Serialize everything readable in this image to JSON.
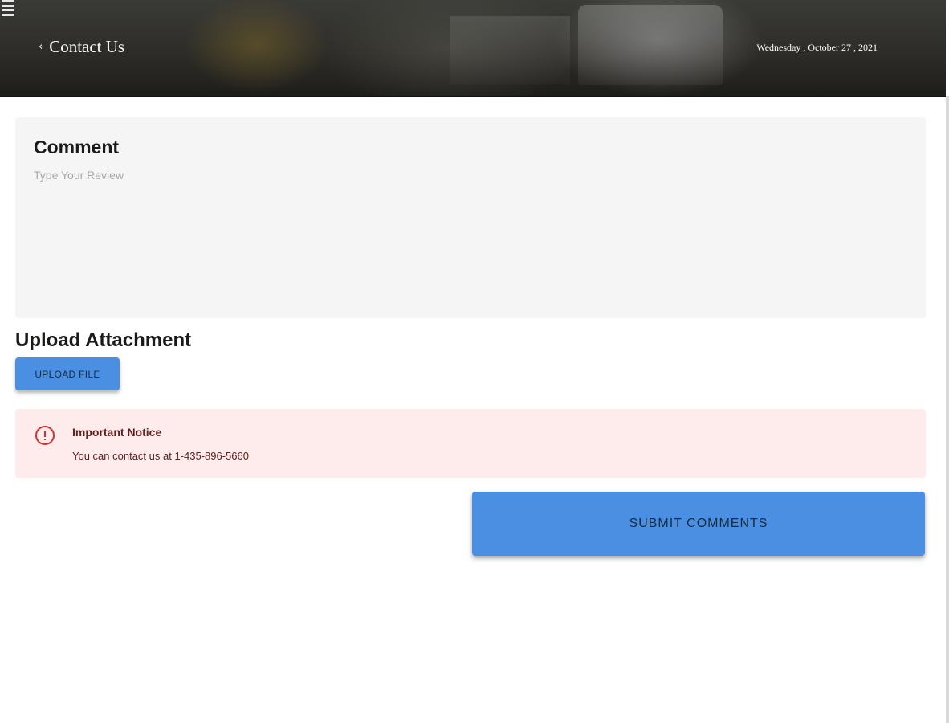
{
  "header": {
    "back_icon": "chevron-left-icon",
    "title": "Contact Us",
    "date": "Wednesday , October 27 , 2021",
    "menu_icon": "hamburger-menu-icon"
  },
  "comment": {
    "label": "Comment",
    "placeholder": "Type Your Review",
    "value": ""
  },
  "upload": {
    "heading": "Upload Attachment",
    "button_label": "UPLOAD FILE"
  },
  "notice": {
    "icon": "alert-circle-icon",
    "title": "Important Notice",
    "text": "You can contact us at 1-435-896-5660"
  },
  "submit": {
    "label": "SUBMIT COMMENTS"
  },
  "colors": {
    "primary_button": "#4a8fe2",
    "notice_background": "#fdeceb",
    "notice_icon": "#d32f2f",
    "comment_background": "#f5f5f5"
  }
}
